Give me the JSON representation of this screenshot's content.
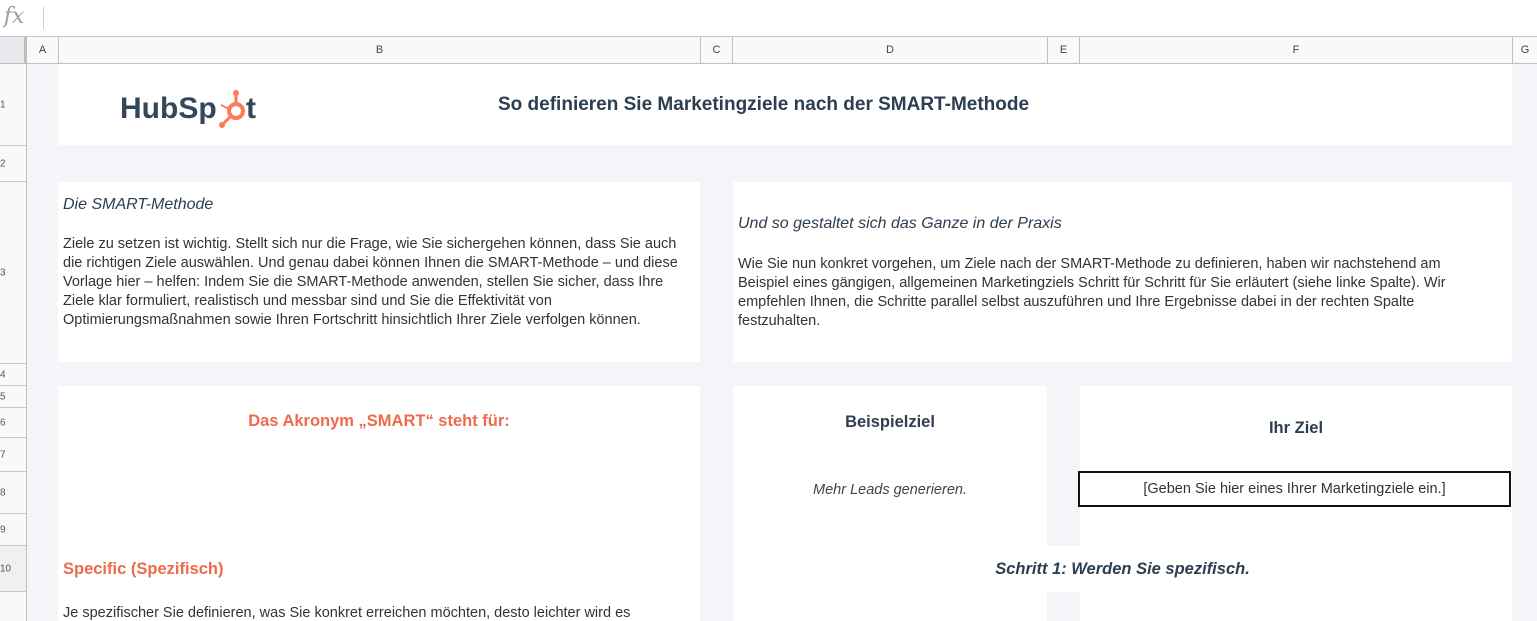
{
  "formula_bar": {
    "icon": "fx",
    "value": ""
  },
  "columns": [
    "A",
    "B",
    "C",
    "D",
    "E",
    "F",
    "G"
  ],
  "rows": [
    "1",
    "2",
    "3",
    "4",
    "5",
    "6",
    "7",
    "8",
    "9",
    "10"
  ],
  "header": {
    "logo_text": "HubSpot",
    "title": "So definieren Sie Marketingziele nach der SMART-Methode"
  },
  "intro_left": {
    "title": "Die SMART-Methode",
    "body": "Ziele zu setzen ist wichtig. Stellt sich nur die Frage, wie Sie sichergehen können, dass Sie auch die richtigen Ziele auswählen. Und genau dabei können Ihnen die SMART-Methode – und diese Vorlage hier – helfen: Indem Sie die SMART-Methode anwenden, stellen Sie sicher, dass Ihre Ziele klar formuliert, realistisch und messbar sind und Sie die Effektivität von Optimierungsmaßnahmen sowie Ihren Fortschritt hinsichtlich Ihrer Ziele verfolgen können."
  },
  "intro_right": {
    "title": "Und so gestaltet sich das Ganze in der Praxis",
    "body": "Wie Sie nun konkret vorgehen, um Ziele nach der SMART-Methode zu definieren, haben wir nachstehend am Beispiel eines gängigen, allgemeinen Marketingziels Schritt für Schritt für Sie erläutert (siehe linke Spalte). Wir empfehlen Ihnen, die Schritte parallel selbst auszuführen und Ihre Ergebnisse dabei in der rechten Spalte festzuhalten."
  },
  "acronym_heading": "Das Akronym „SMART“ steht für:",
  "example_col": {
    "heading": "Beispielziel",
    "value": "Mehr Leads generieren."
  },
  "your_col": {
    "heading": "Ihr Ziel",
    "placeholder": "[Geben Sie hier eines Ihrer Marketingziele ein.]"
  },
  "specific": {
    "heading": "Specific (Spezifisch)",
    "body": "Je spezifischer Sie definieren, was Sie konkret erreichen möchten, desto leichter wird es"
  },
  "step1": "Schritt 1: Werden Sie spezifisch.",
  "colors": {
    "orange": "#ee6a4b",
    "navy": "#2d3e50",
    "sheet_bg": "#f3f5f8"
  }
}
